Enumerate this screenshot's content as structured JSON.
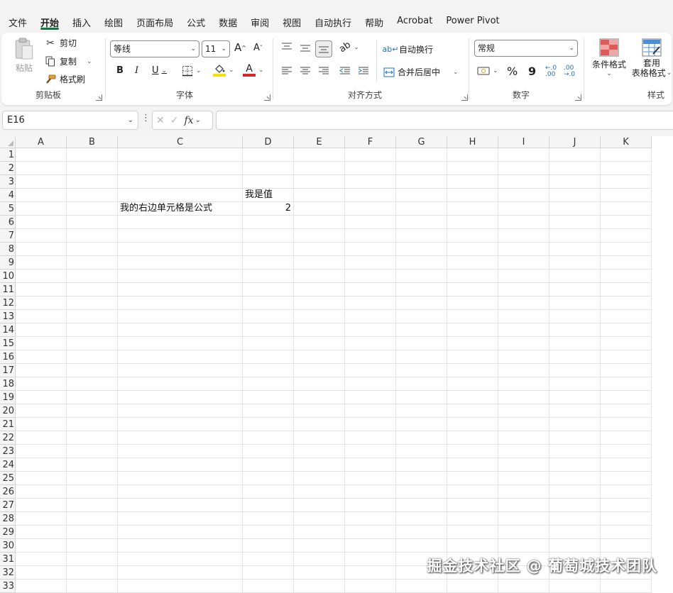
{
  "menu": [
    "文件",
    "开始",
    "插入",
    "绘图",
    "页面布局",
    "公式",
    "数据",
    "审阅",
    "视图",
    "自动执行",
    "帮助",
    "Acrobat",
    "Power Pivot"
  ],
  "menu_active": 1,
  "ribbon": {
    "clipboard": {
      "paste": "粘贴",
      "cut": "剪切",
      "copy": "复制",
      "format_painter": "格式刷",
      "label": "剪贴板"
    },
    "font": {
      "name": "等线",
      "size": "11",
      "grow": "A",
      "shrink": "A",
      "bold": "B",
      "italic": "I",
      "underline": "U",
      "font_color_letter": "A",
      "label": "字体"
    },
    "alignment": {
      "wrap_text": "自动换行",
      "merge_center": "合并后居中",
      "label": "对齐方式"
    },
    "number": {
      "format": "常规",
      "percent": "%",
      "comma": "9",
      "label": "数字"
    },
    "styles": {
      "conditional": "条件格式",
      "table_format_line1": "套用",
      "table_format_line2": "表格格式",
      "label": "样式"
    },
    "colors": {
      "highlight": "#f8e000",
      "font_color": "#d6262a",
      "accent": "#107c41"
    }
  },
  "formula_bar": {
    "cell_ref": "E16",
    "fx": "fx",
    "cancel": "✕",
    "enter": "✓"
  },
  "columns": [
    "A",
    "B",
    "C",
    "D",
    "E",
    "F",
    "G",
    "H",
    "I",
    "J",
    "K"
  ],
  "rows_count": 33,
  "cell_values": {
    "D4": "我是值",
    "C5": "我的右边单元格是公式",
    "D5": "2"
  },
  "watermark": "掘金技术社区 @ 葡萄城技术团队"
}
